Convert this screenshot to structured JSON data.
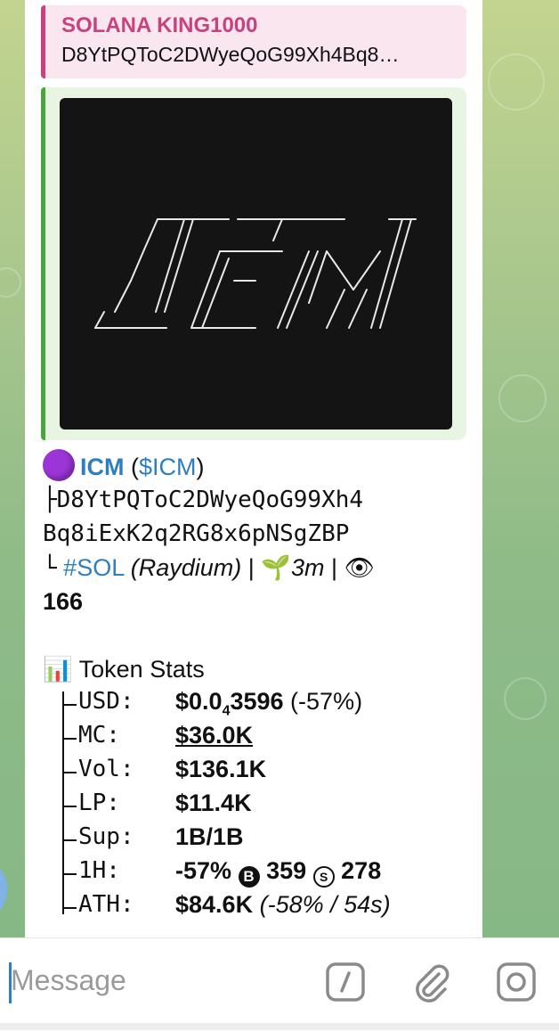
{
  "reply": {
    "name": "SOLANA KING1000",
    "text": "D8YtPQToC2DWyeQoG99Xh4Bq8…"
  },
  "token": {
    "name": "ICM",
    "ticker_open": "(",
    "ticker": "$ICM",
    "ticker_close": ")",
    "address_line1": "D8YtPQToC2DWyeQoG99Xh4",
    "address_line2": "Bq8iExK2q2RG8x6pNSgZBP",
    "chain_tag": "#SOL",
    "dex": "(Raydium)",
    "sep": "|",
    "age": "3m",
    "views": "166"
  },
  "stats": {
    "title": "Token Stats",
    "rows": [
      {
        "key": "USD:",
        "value": "$0.0",
        "sub": "4",
        "value2": "3596",
        "extra": " (-57%)"
      },
      {
        "key": "MC:",
        "value": "$36.0K"
      },
      {
        "key": "Vol:",
        "value": "$136.1K"
      },
      {
        "key": "LP:",
        "value": "$11.4K"
      },
      {
        "key": "Sup:",
        "value": "1B/1B"
      },
      {
        "key": "1H:",
        "value": "-57%",
        "buys": "359",
        "sells": "278"
      },
      {
        "key": "ATH:",
        "value": "$84.6K",
        "extra": "(-58% / 54s)"
      }
    ]
  },
  "input": {
    "placeholder": "Message"
  },
  "colors": {
    "reply_accent": "#c9427d",
    "media_accent": "#4aa53c",
    "link": "#2f7fbf",
    "chat_bg": "#9fc08e"
  }
}
